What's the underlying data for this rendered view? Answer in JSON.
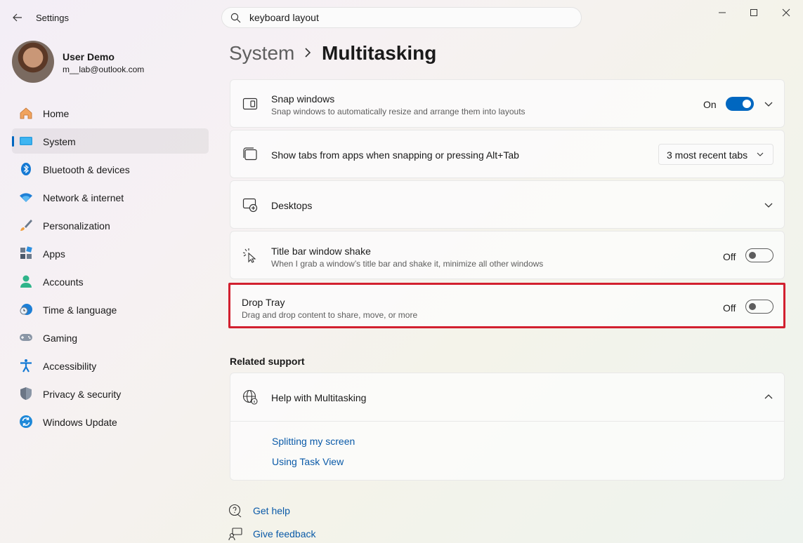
{
  "window": {
    "title": "Settings"
  },
  "search": {
    "value": "keyboard layout"
  },
  "user": {
    "name": "User Demo",
    "email": "m__lab@outlook.com"
  },
  "nav": [
    {
      "label": "Home",
      "icon": "home-icon",
      "active": false
    },
    {
      "label": "System",
      "icon": "system-icon",
      "active": true
    },
    {
      "label": "Bluetooth & devices",
      "icon": "bluetooth-icon",
      "active": false
    },
    {
      "label": "Network & internet",
      "icon": "wifi-icon",
      "active": false
    },
    {
      "label": "Personalization",
      "icon": "brush-icon",
      "active": false
    },
    {
      "label": "Apps",
      "icon": "apps-icon",
      "active": false
    },
    {
      "label": "Accounts",
      "icon": "accounts-icon",
      "active": false
    },
    {
      "label": "Time & language",
      "icon": "clock-globe-icon",
      "active": false
    },
    {
      "label": "Gaming",
      "icon": "gamepad-icon",
      "active": false
    },
    {
      "label": "Accessibility",
      "icon": "accessibility-icon",
      "active": false
    },
    {
      "label": "Privacy & security",
      "icon": "shield-icon",
      "active": false
    },
    {
      "label": "Windows Update",
      "icon": "update-icon",
      "active": false
    }
  ],
  "breadcrumb": {
    "parent": "System",
    "current": "Multitasking"
  },
  "settings": {
    "snap": {
      "title": "Snap windows",
      "desc": "Snap windows to automatically resize and arrange them into layouts",
      "state": "On"
    },
    "tabs": {
      "title": "Show tabs from apps when snapping or pressing Alt+Tab",
      "selected": "3 most recent tabs"
    },
    "desktops": {
      "title": "Desktops"
    },
    "shake": {
      "title": "Title bar window shake",
      "desc": "When I grab a window’s title bar and shake it, minimize all other windows",
      "state": "Off"
    },
    "droptray": {
      "title": "Drop Tray",
      "desc": "Drag and drop content to share, move, or more",
      "state": "Off"
    }
  },
  "related": {
    "title": "Related support",
    "help_title": "Help with Multitasking",
    "links": [
      "Splitting my screen",
      "Using Task View"
    ]
  },
  "footer": {
    "get_help": "Get help",
    "feedback": "Give feedback"
  },
  "colors": {
    "accent": "#0067c0",
    "highlight": "#d2202f",
    "link": "#0a5aa8"
  }
}
